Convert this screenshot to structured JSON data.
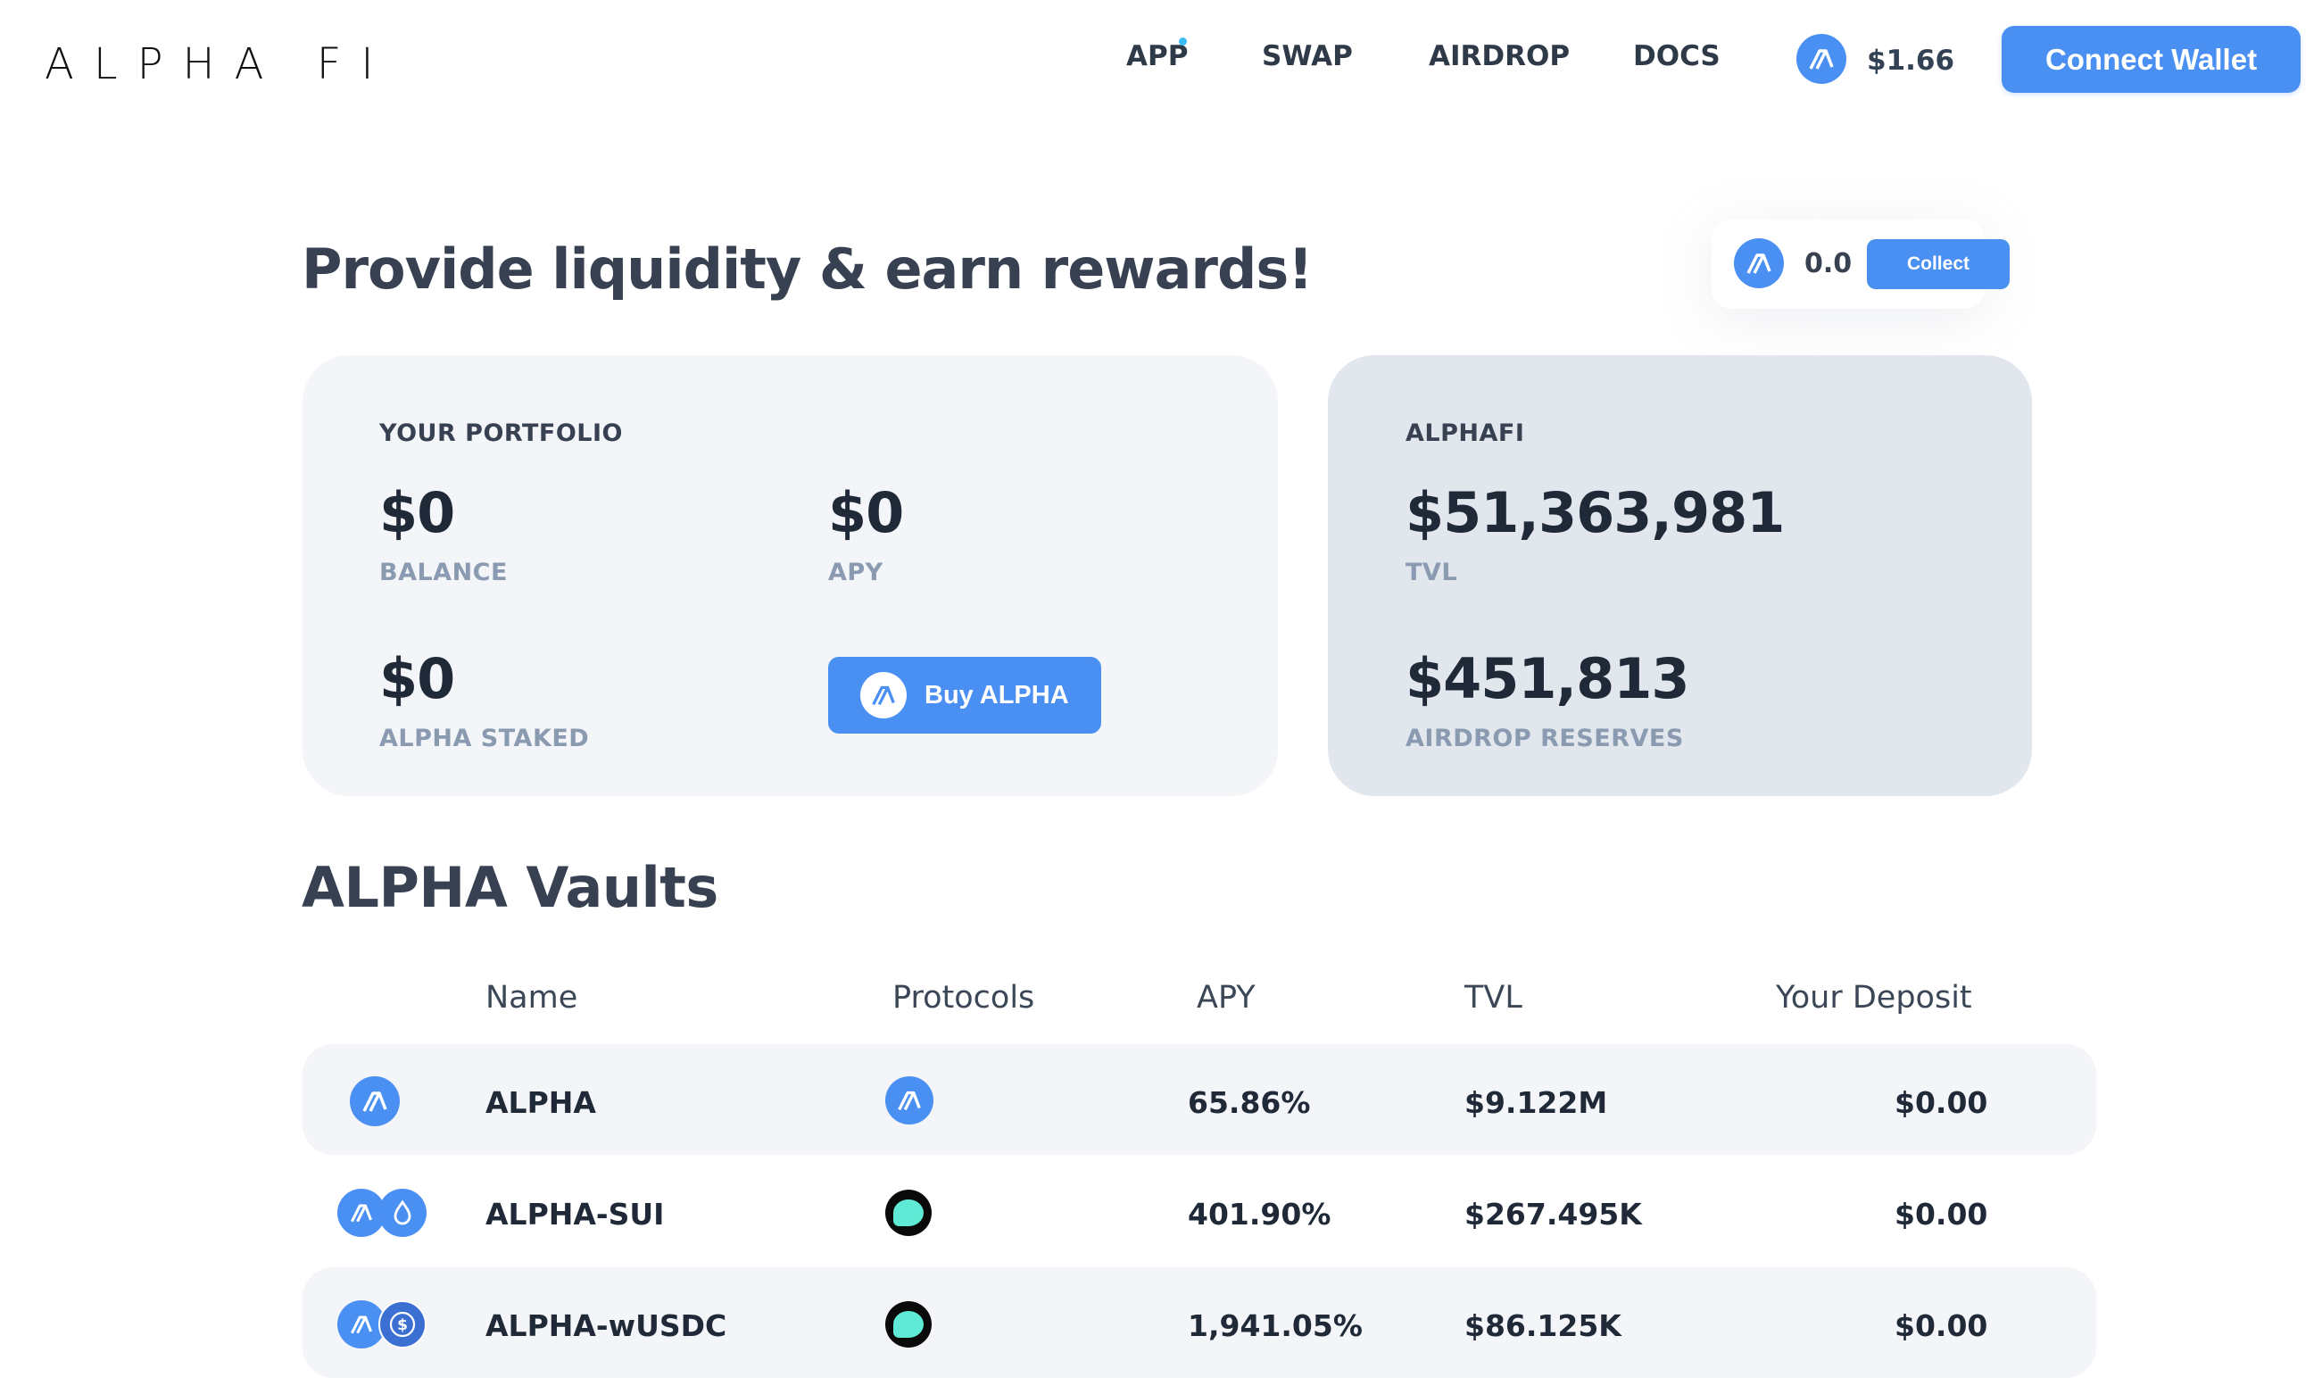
{
  "header": {
    "logo": "ALPHA FI",
    "nav": [
      "APP",
      "SWAP",
      "AIRDROP",
      "DOCS"
    ],
    "price": "$1.66",
    "connect_label": "Connect Wallet"
  },
  "hero": {
    "title": "Provide liquidity & earn rewards!",
    "reward_value": "0.0",
    "collect_label": "Collect"
  },
  "portfolio": {
    "label": "YOUR PORTFOLIO",
    "balance_value": "$0",
    "balance_label": "BALANCE",
    "apy_value": "$0",
    "apy_label": "APY",
    "staked_value": "$0",
    "staked_label": "ALPHA STAKED",
    "buy_label": "Buy ALPHA"
  },
  "alphafi": {
    "label": "ALPHAFI",
    "tvl_value": "$51,363,981",
    "tvl_label": "TVL",
    "reserves_value": "$451,813",
    "reserves_label": "AIRDROP RESERVES"
  },
  "vaults": {
    "title": "ALPHA Vaults",
    "columns": [
      "Name",
      "Protocols",
      "APY",
      "TVL",
      "Your Deposit"
    ],
    "rows": [
      {
        "name": "ALPHA",
        "apy": "65.86%",
        "tvl": "$9.122M",
        "deposit": "$0.00"
      },
      {
        "name": "ALPHA-SUI",
        "apy": "401.90%",
        "tvl": "$267.495K",
        "deposit": "$0.00"
      },
      {
        "name": "ALPHA-wUSDC",
        "apy": "1,941.05%",
        "tvl": "$86.125K",
        "deposit": "$0.00"
      }
    ]
  },
  "colors": {
    "accent": "#4a8ff2",
    "card_light": "#f3f5f8",
    "card_dark": "#e2e7ee"
  },
  "icons": [
    "alpha-icon",
    "cetus-icon",
    "sui-drop-icon",
    "usdc-icon"
  ]
}
